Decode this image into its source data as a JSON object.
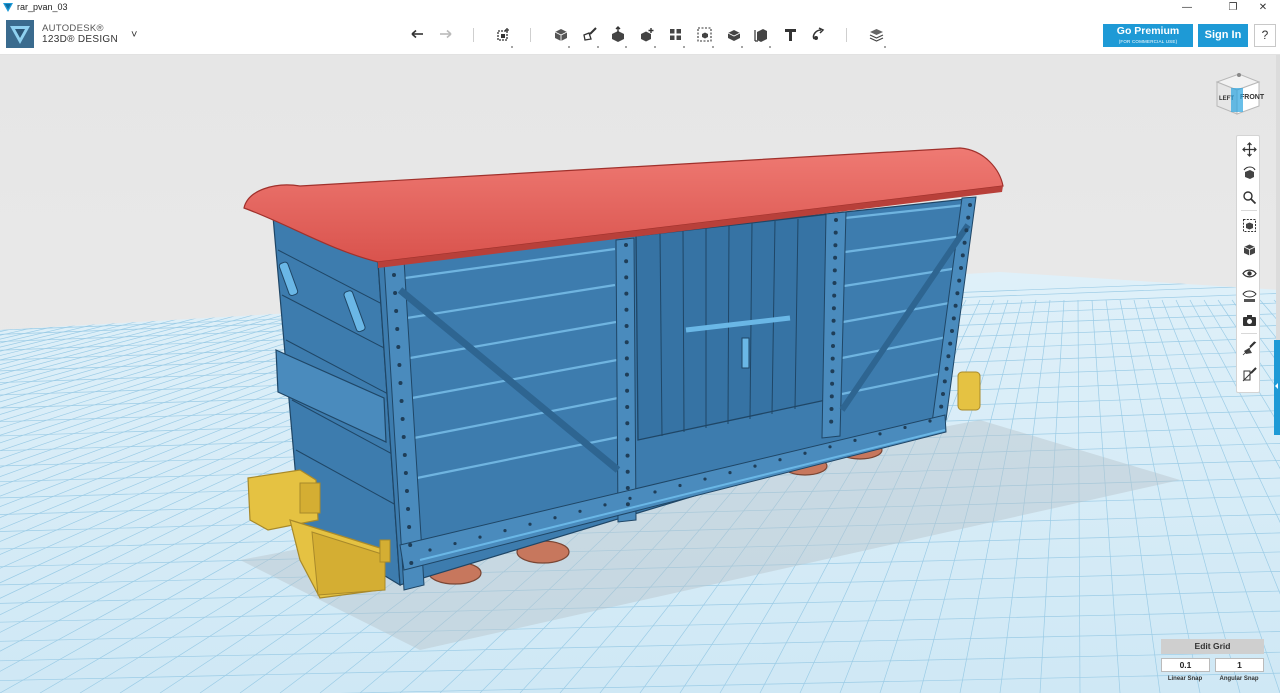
{
  "window": {
    "title": "rar_pvan_03",
    "minimize": "—",
    "restore": "❐",
    "close": "✕"
  },
  "brand": {
    "company": "AUTODESK®",
    "product": "123D® DESIGN",
    "menu_chevron": "˅"
  },
  "toolbar": {
    "tools": [
      {
        "name": "undo-icon"
      },
      {
        "name": "redo-icon"
      },
      {
        "name": "transform-icon"
      },
      {
        "name": "primitives-icon"
      },
      {
        "name": "sketch-icon"
      },
      {
        "name": "construct-icon"
      },
      {
        "name": "modify-icon"
      },
      {
        "name": "pattern-icon"
      },
      {
        "name": "group-icon"
      },
      {
        "name": "combine-icon"
      },
      {
        "name": "measure-icon"
      },
      {
        "name": "text-icon"
      },
      {
        "name": "snap-icon"
      },
      {
        "name": "material-icon"
      }
    ]
  },
  "account": {
    "premium_label": "Go Premium",
    "premium_sub": "(FOR COMMERCIAL USE)",
    "signin_label": "Sign In",
    "help_label": "?"
  },
  "viewcube": {
    "left_label": "LEFT",
    "front_label": "FRONT"
  },
  "navbar": {
    "items": [
      "pan-icon",
      "orbit-icon",
      "zoom-icon",
      "fit-icon",
      "view-icon",
      "visibility-icon",
      "material-visibility-icon",
      "screenshot-icon",
      "sketch-visibility-icon",
      "hide-sketch-icon"
    ]
  },
  "grid": {
    "edit_label": "Edit Grid",
    "linear_value": "0.1",
    "angular_value": "1",
    "linear_label": "Linear Snap",
    "angular_label": "Angular Snap"
  },
  "colors": {
    "accent": "#1e9ad6",
    "body_blue": "#3d7cae",
    "roof_red": "#e8625c",
    "buffer_yellow": "#e5c242",
    "grid_blue": "#8fc7e4"
  }
}
